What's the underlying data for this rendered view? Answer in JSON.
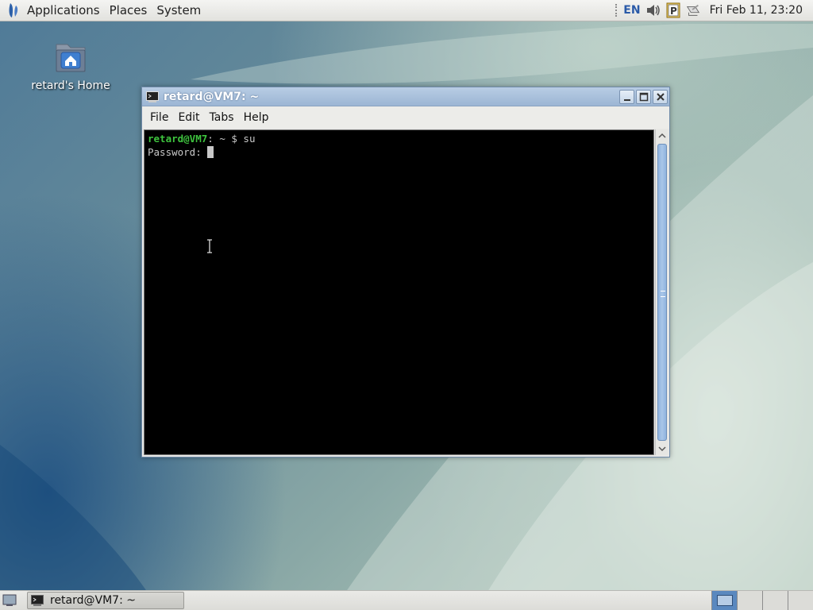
{
  "top_panel": {
    "menus": [
      "Applications",
      "Places",
      "System"
    ],
    "keyboard_layout": "EN",
    "clock": "Fri Feb 11, 23:20"
  },
  "desktop": {
    "icons": [
      {
        "label": "retard's Home",
        "icon": "home-folder-icon"
      }
    ]
  },
  "window": {
    "title": "retard@VM7: ~",
    "menus": [
      "File",
      "Edit",
      "Tabs",
      "Help"
    ],
    "terminal": {
      "prompt_user": "retard@VM7",
      "prompt_rest": ": ~ $ su",
      "line2": "Password: "
    }
  },
  "bottom_panel": {
    "task_label": "retard@VM7: ~",
    "workspace_count": 4,
    "active_workspace": 1
  },
  "colors": {
    "prompt_green": "#3ec43e",
    "titlebar": "#9cb6d4",
    "scroll_thumb": "#a9c6e8"
  }
}
